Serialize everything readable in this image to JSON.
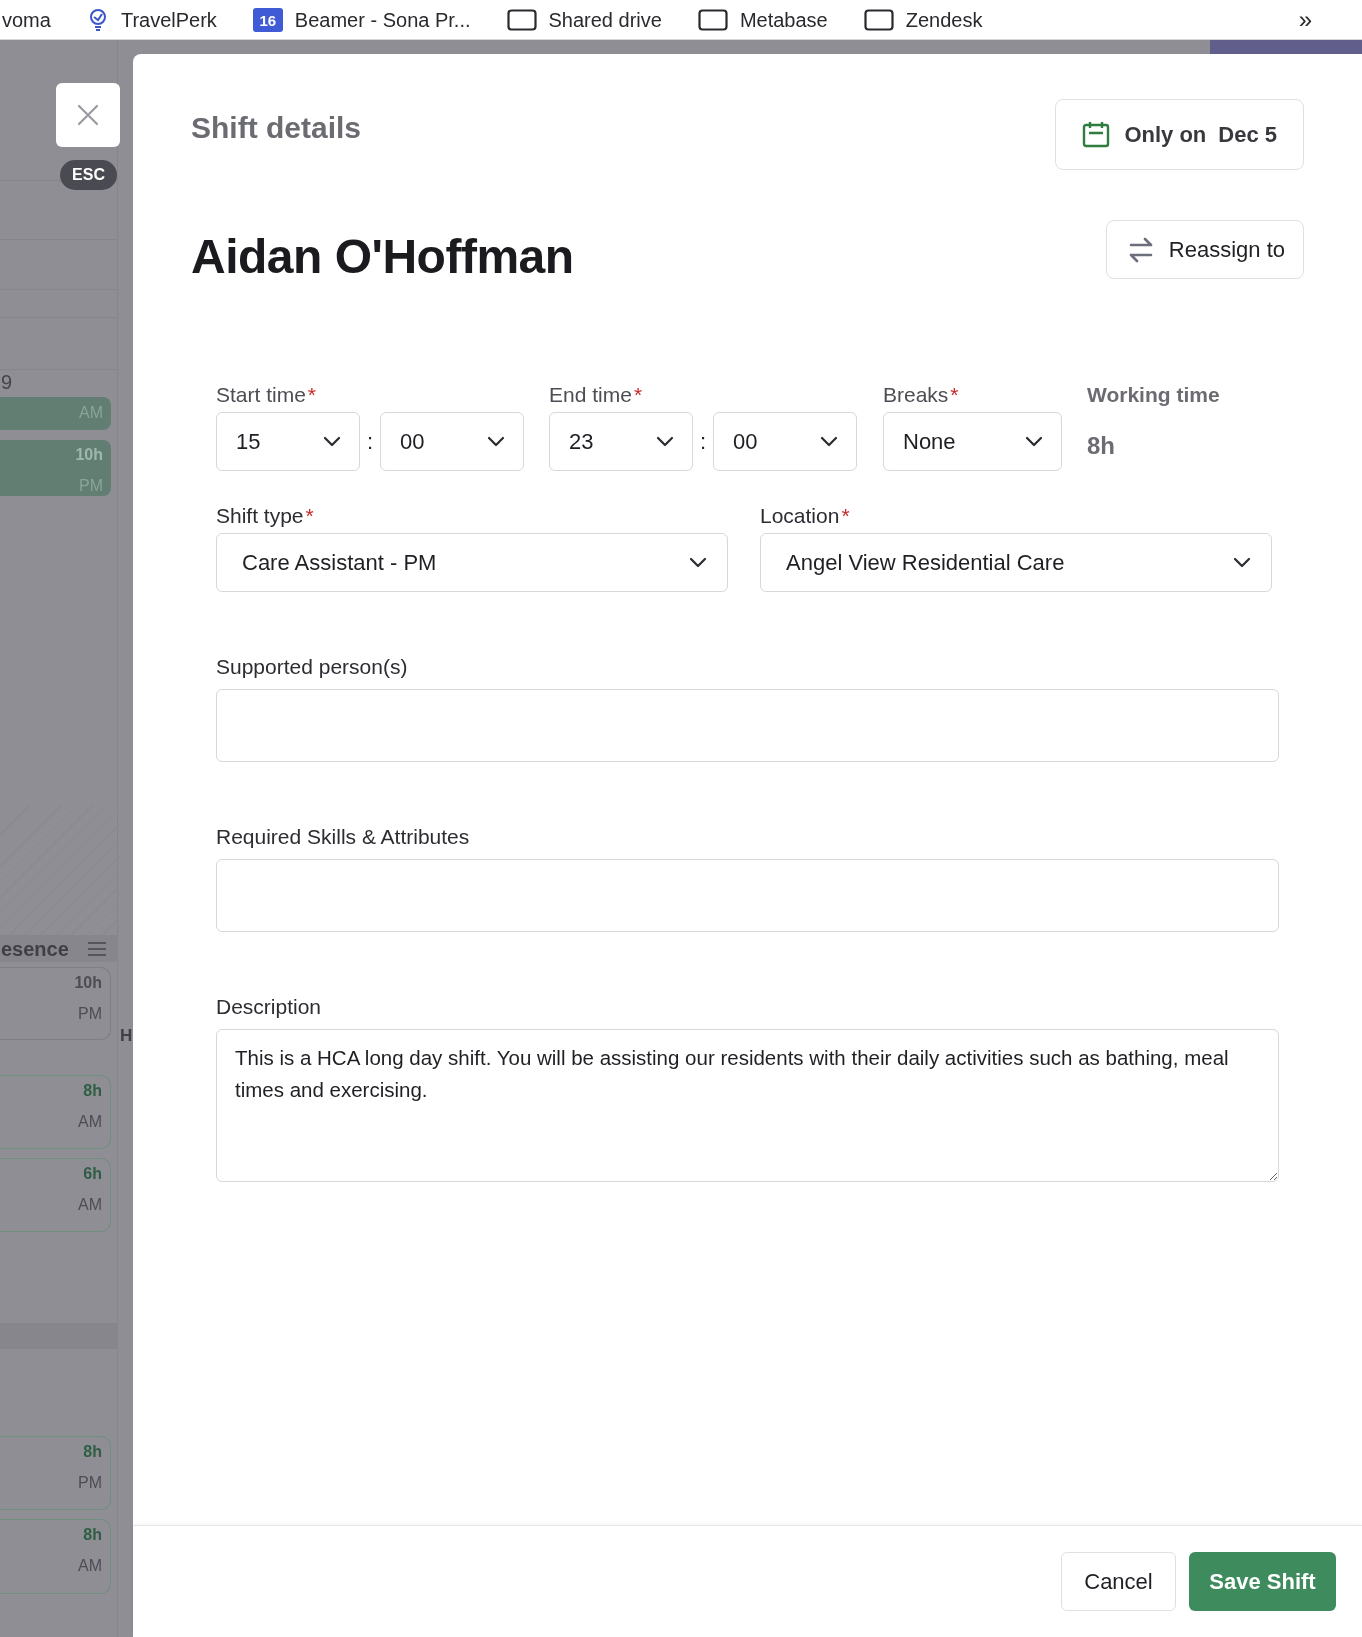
{
  "bookmarks": [
    {
      "kind": "plain",
      "label": "voma"
    },
    {
      "kind": "bulb",
      "label": "TravelPerk"
    },
    {
      "kind": "calendar",
      "badge": "16",
      "label": "Beamer - Sona Pr..."
    },
    {
      "kind": "folder",
      "label": "Shared drive"
    },
    {
      "kind": "folder",
      "label": "Metabase"
    },
    {
      "kind": "folder",
      "label": "Zendesk"
    }
  ],
  "bookmarks_more": "»",
  "backdrop": {
    "row_label": "9",
    "cards_top": [
      {
        "kind": "filled",
        "period": "AM"
      },
      {
        "kind": "filled",
        "hours": "10h",
        "period": "PM"
      }
    ],
    "section": "esence",
    "cards_mid": [
      {
        "kind": "muted",
        "hours": "10h",
        "period": "PM"
      },
      {
        "kind": "green",
        "hours": "8h",
        "period": "AM"
      },
      {
        "kind": "green",
        "hours": "6h",
        "period": "AM"
      }
    ],
    "side_letter": "H",
    "cards_bottom": [
      {
        "kind": "green",
        "hours": "8h",
        "period": "PM"
      },
      {
        "kind": "green",
        "hours": "8h",
        "period": "AM"
      }
    ]
  },
  "esc_badge": "ESC",
  "panel": {
    "title": "Shift details",
    "scope_label": "Only on",
    "scope_date": "Dec 5",
    "employee_name": "Aidan O'Hoffman",
    "reassign_button": "Reassign to",
    "start_time": {
      "label": "Start time",
      "required_mark": "*",
      "hour": "15",
      "separator": ":",
      "minute": "00"
    },
    "end_time": {
      "label": "End time",
      "required_mark": "*",
      "hour": "23",
      "separator": ":",
      "minute": "00"
    },
    "breaks": {
      "label": "Breaks",
      "required_mark": "*",
      "value": "None"
    },
    "working_time": {
      "label": "Working time",
      "value": "8h"
    },
    "shift_type": {
      "label": "Shift type",
      "required_mark": "*",
      "value": "Care Assistant - PM"
    },
    "location": {
      "label": "Location",
      "required_mark": "*",
      "value": "Angel View Residential Care"
    },
    "supported_persons": {
      "label": "Supported person(s)"
    },
    "required_skills": {
      "label": "Required Skills & Attributes"
    },
    "description": {
      "label": "Description",
      "value": "This is a HCA long day shift. You will be assisting our residents with their daily activities such as bathing, meal times and exercising."
    }
  },
  "footer": {
    "cancel": "Cancel",
    "save": "Save Shift"
  }
}
